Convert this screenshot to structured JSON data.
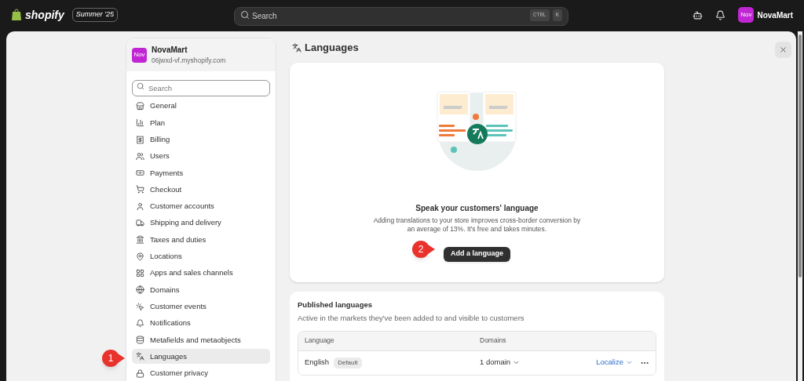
{
  "topbar": {
    "brand": "shopify",
    "edition": "Summer '25",
    "search": {
      "placeholder": "Search"
    },
    "shortcut": [
      "CTRL",
      "K"
    ],
    "user": {
      "avatar": "Nov",
      "name": "NovaMart"
    }
  },
  "sidebar": {
    "store": {
      "avatar": "Nov",
      "name": "NovaMart",
      "domain": "06jwxd-vf.myshopify.com"
    },
    "search": {
      "placeholder": "Search"
    },
    "items": [
      {
        "label": "General",
        "selected": false
      },
      {
        "label": "Plan",
        "selected": false
      },
      {
        "label": "Billing",
        "selected": false
      },
      {
        "label": "Users",
        "selected": false
      },
      {
        "label": "Payments",
        "selected": false
      },
      {
        "label": "Checkout",
        "selected": false
      },
      {
        "label": "Customer accounts",
        "selected": false
      },
      {
        "label": "Shipping and delivery",
        "selected": false
      },
      {
        "label": "Taxes and duties",
        "selected": false
      },
      {
        "label": "Locations",
        "selected": false
      },
      {
        "label": "Apps and sales channels",
        "selected": false
      },
      {
        "label": "Domains",
        "selected": false
      },
      {
        "label": "Customer events",
        "selected": false
      },
      {
        "label": "Notifications",
        "selected": false
      },
      {
        "label": "Metafields and metaobjects",
        "selected": false
      },
      {
        "label": "Languages",
        "selected": true
      },
      {
        "label": "Customer privacy",
        "selected": false
      }
    ]
  },
  "page": {
    "title": "Languages",
    "empty_state": {
      "title": "Speak your customers' language",
      "description": "Adding translations to your store improves cross-border conversion by an average of 13%. It's free and takes minutes.",
      "button": "Add a language"
    },
    "published": {
      "title": "Published languages",
      "subtitle": "Active in the markets they've been added to and visible to customers",
      "columns": [
        "Language",
        "Domains"
      ],
      "rows": [
        {
          "language": "English",
          "badge": "Default",
          "domains": "1 domain",
          "action": "Localize"
        }
      ]
    }
  },
  "annotations": [
    {
      "label": "1"
    },
    {
      "label": "2"
    }
  ]
}
